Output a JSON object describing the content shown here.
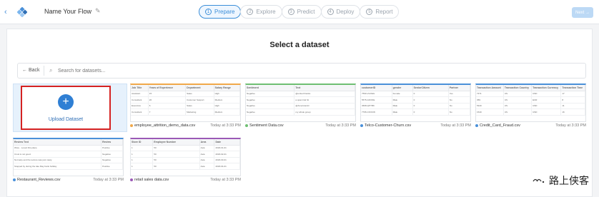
{
  "header": {
    "flow_name": "Name Your Flow",
    "steps": [
      {
        "num": "1",
        "label": "Prepare"
      },
      {
        "num": "2",
        "label": "Explore"
      },
      {
        "num": "3",
        "label": "Predict"
      },
      {
        "num": "4",
        "label": "Deploy"
      },
      {
        "num": "5",
        "label": "Report"
      }
    ],
    "next_label": "Next →",
    "accent": "#3b8ed8"
  },
  "main": {
    "title": "Select a dataset",
    "back_label": "← Back",
    "search_placeholder": "Search for datasets...",
    "upload_label": "Upload Dataset",
    "upload_icon": "plus-icon"
  },
  "datasets": [
    {
      "name": "employee_attrition_demo_data.csv",
      "date": "Today at 3:33 PM",
      "accent": "#f0a84a",
      "columns": [
        "Job Title",
        "Years of Experience",
        "Department",
        "Salary Range"
      ],
      "rows": [
        [
          "Assistant",
          "15",
          "Sales",
          "High"
        ],
        [
          "Consultant",
          "20",
          "Customer Support",
          "Medium"
        ],
        [
          "Executive",
          "6",
          "Sales",
          "High"
        ],
        [
          "Consultant",
          "7",
          "Marketing",
          "Medium"
        ]
      ]
    },
    {
      "name": "Sentiment Data.csv",
      "date": "Today at 3:33 PM",
      "accent": "#6fbf73",
      "columns": [
        "Sentiment",
        "Text"
      ],
      "rows": [
        [
          "Negative",
          "@united thanks"
        ],
        [
          "Negative",
          "a quiet trial hit"
        ],
        [
          "Negative",
          "@AmericanAir"
        ],
        [
          "Negative",
          "my whole group"
        ]
      ]
    },
    {
      "name": "Telco-Customer-Churn.csv",
      "date": "Today at 3:33 PM",
      "accent": "#4a90d9",
      "columns": [
        "customerID",
        "gender",
        "SeniorCitizen",
        "Partner"
      ],
      "rows": [
        [
          "7590-VHVEG",
          "Female",
          "0",
          "Yes"
        ],
        [
          "5575-GNVDE",
          "Male",
          "0",
          "No"
        ],
        [
          "3668-QPYBK",
          "Male",
          "0",
          "No"
        ],
        [
          "7795-CFOCW",
          "Male",
          "0",
          "No"
        ]
      ]
    },
    {
      "name": "Credit_Card_Fraud.csv",
      "date": "Today at 3:33 PM",
      "accent": "#4a90d9",
      "columns": [
        "Transaction Amount",
        "Transaction Country",
        "Transaction Currency",
        "Transaction Time"
      ],
      "rows": [
        [
          "7371",
          "US",
          "USD",
          "17"
        ],
        [
          "359",
          "US",
          "EUR",
          "8"
        ],
        [
          "5340",
          "US",
          "USD",
          "11"
        ],
        [
          "1540",
          "US",
          "USD",
          "16"
        ]
      ]
    },
    {
      "name": "Restaurant_Reviews.csv",
      "date": "Today at 3:33 PM",
      "accent": "#4a90d9",
      "columns": [
        "Review Text",
        "Review"
      ],
      "rows": [
        [
          "Wow... Loved this place.",
          "Positive"
        ],
        [
          "Crust is not good.",
          "Negative"
        ],
        [
          "Not tasty and the texture was just nasty.",
          "Negative"
        ],
        [
          "Stopped by during the late May bank holiday",
          "Positive"
        ]
      ]
    },
    {
      "name": "retail sales data.csv",
      "date": "Today at 3:33 PM",
      "accent": "#9b59b6",
      "columns": [
        "Store ID",
        "Employee Number",
        "Area",
        "Date"
      ],
      "rows": [
        [
          "1",
          "50",
          "Asia",
          "2018-01-01"
        ],
        [
          "1",
          "50",
          "Asia",
          "2018-02-01"
        ],
        [
          "1",
          "50",
          "Asia",
          "2018-03-01"
        ],
        [
          "1",
          "50",
          "Asia",
          "2018-04-01"
        ]
      ]
    }
  ],
  "watermark": {
    "text": "路上侠客"
  }
}
